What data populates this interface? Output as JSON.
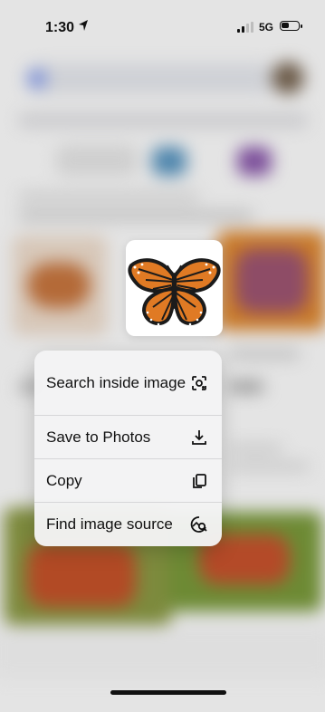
{
  "status_bar": {
    "time": "1:30",
    "network": "5G",
    "location_icon": "location-arrow-icon",
    "signal_icon": "cellular-signal-icon",
    "battery_icon": "battery-icon"
  },
  "preview": {
    "subject": "butterfly-image",
    "colors": {
      "wing": "#e07a24",
      "vein": "#1b1b1b",
      "spot": "#ffffff"
    }
  },
  "menu": {
    "items": [
      {
        "label": "Search inside image",
        "icon": "lens-search-icon"
      },
      {
        "label": "Save to Photos",
        "icon": "download-icon"
      },
      {
        "label": "Copy",
        "icon": "copy-icon"
      },
      {
        "label": "Find image source",
        "icon": "image-search-icon"
      }
    ]
  }
}
